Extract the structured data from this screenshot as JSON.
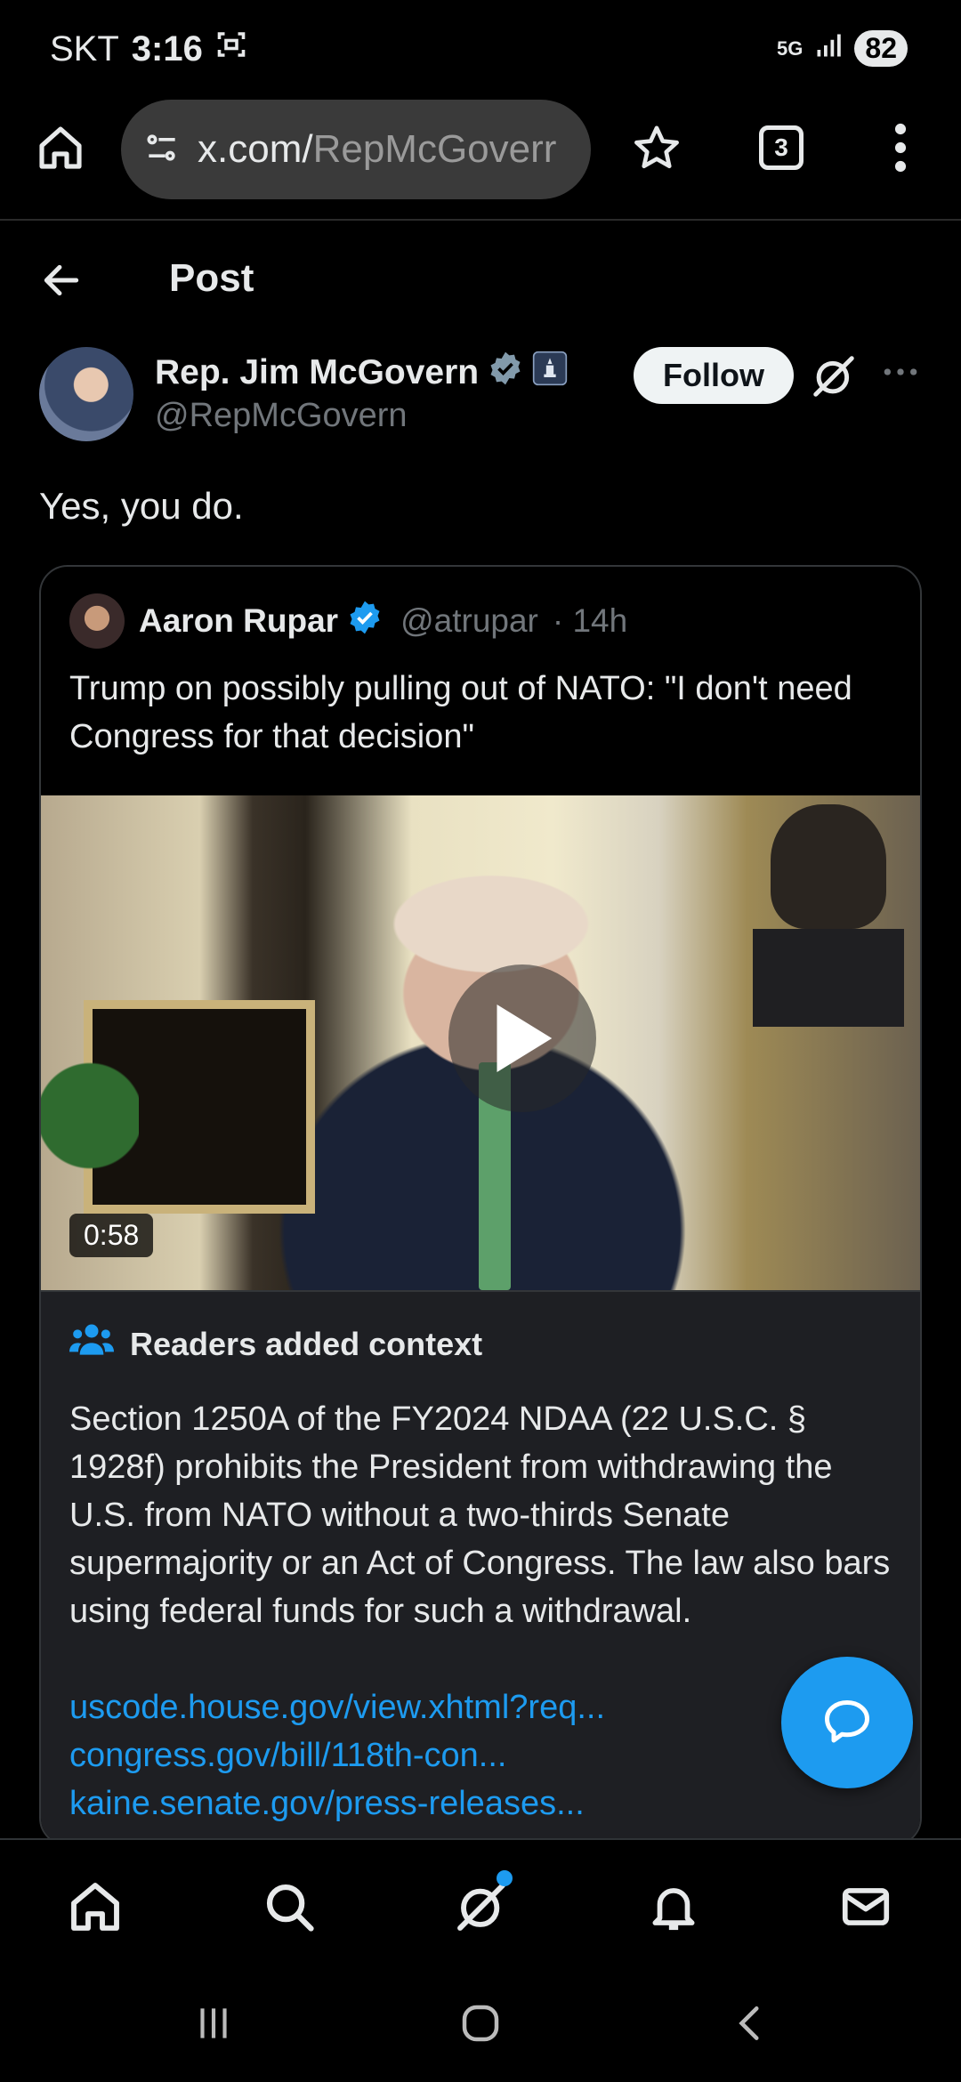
{
  "status_bar": {
    "carrier": "SKT",
    "time": "3:16",
    "network": "5G",
    "battery": "82"
  },
  "browser": {
    "url_host": "x.com/",
    "url_path": "RepMcGoverr",
    "tab_count": "3"
  },
  "header": {
    "title": "Post"
  },
  "post": {
    "author_name": "Rep. Jim McGovern",
    "author_handle": "@RepMcGovern",
    "follow_label": "Follow",
    "text": "Yes, you do."
  },
  "quote": {
    "author_name": "Aaron Rupar",
    "author_handle": "@atrupar",
    "time": "· 14h",
    "text": "Trump on possibly pulling out of NATO: \"I don't need Congress for that decision\"",
    "video_duration": "0:58"
  },
  "context": {
    "heading": "Readers added context",
    "text": "Section 1250A of the FY2024 NDAA (22 U.S.C. § 1928f) prohibits the President from withdrawing the U.S. from NATO without a two-thirds Senate supermajority or an Act of Congress. The law also bars using federal funds for such a withdrawal.",
    "links": [
      "uscode.house.gov/view.xhtml?req...",
      "congress.gov/bill/118th-con...",
      "kaine.senate.gov/press-releases..."
    ]
  },
  "bottom_nav": [
    "home-icon",
    "search-icon",
    "grok-icon",
    "notifications-icon",
    "messages-icon"
  ],
  "colors": {
    "accent": "#1d9bf0",
    "background": "#000000",
    "secondary_text": "#71767b",
    "context_bg": "#1e1f23"
  }
}
